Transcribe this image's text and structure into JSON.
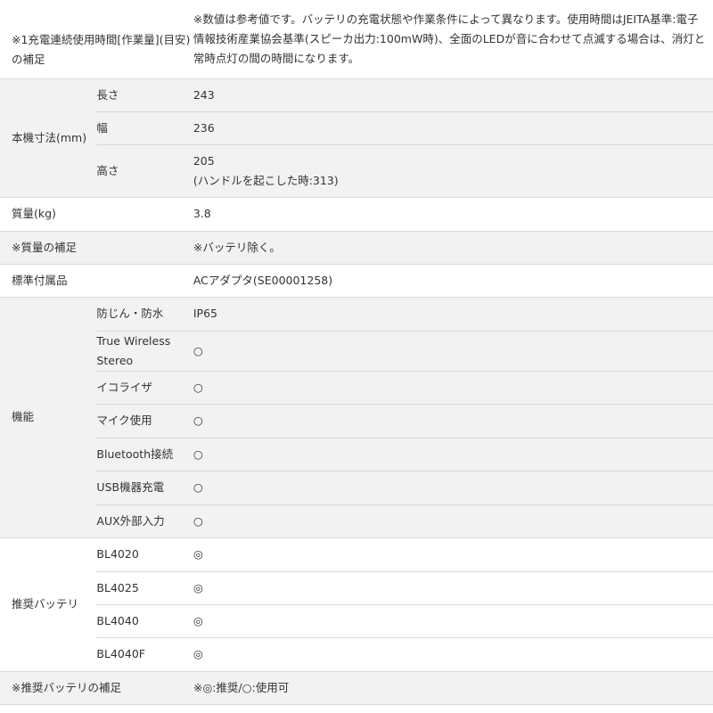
{
  "rows": {
    "usage_note": {
      "label": "※1充電連続使用時間[作業量](目安)の補足",
      "value": "※数値は参考値です。バッテリの充電状態や作業条件によって異なります。使用時間はJEITA基準:電子情報技術産業協会基準(スピーカ出力:100mW時)、全面のLEDが音に合わせて点滅する場合は、消灯と常時点灯の間の時間になります。"
    },
    "dimensions": {
      "label": "本機寸法(mm)",
      "length": {
        "label": "長さ",
        "value": "243"
      },
      "width": {
        "label": "幅",
        "value": "236"
      },
      "height": {
        "label": "高さ",
        "value": "205",
        "value2": "(ハンドルを起こした時:313)"
      }
    },
    "mass": {
      "label": "質量(kg)",
      "value": "3.8"
    },
    "mass_note": {
      "label": "※質量の補足",
      "value": "※バッテリ除く。"
    },
    "accessories": {
      "label": "標準付属品",
      "value": "ACアダプタ(SE00001258)"
    },
    "functions": {
      "label": "機能",
      "items": [
        {
          "label": "防じん・防水",
          "value": "IP65"
        },
        {
          "label": "True Wireless Stereo",
          "value": "○"
        },
        {
          "label": "イコライザ",
          "value": "○"
        },
        {
          "label": "マイク使用",
          "value": "○"
        },
        {
          "label": "Bluetooth接続",
          "value": "○"
        },
        {
          "label": "USB機器充電",
          "value": "○"
        },
        {
          "label": "AUX外部入力",
          "value": "○"
        }
      ]
    },
    "batteries": {
      "label": "推奨バッテリ",
      "items": [
        {
          "label": "BL4020",
          "value": "◎"
        },
        {
          "label": "BL4025",
          "value": "◎"
        },
        {
          "label": "BL4040",
          "value": "◎"
        },
        {
          "label": "BL4040F",
          "value": "◎"
        }
      ]
    },
    "battery_note": {
      "label": "※推奨バッテリの補足",
      "value": "※◎:推奨/○:使用可"
    }
  }
}
